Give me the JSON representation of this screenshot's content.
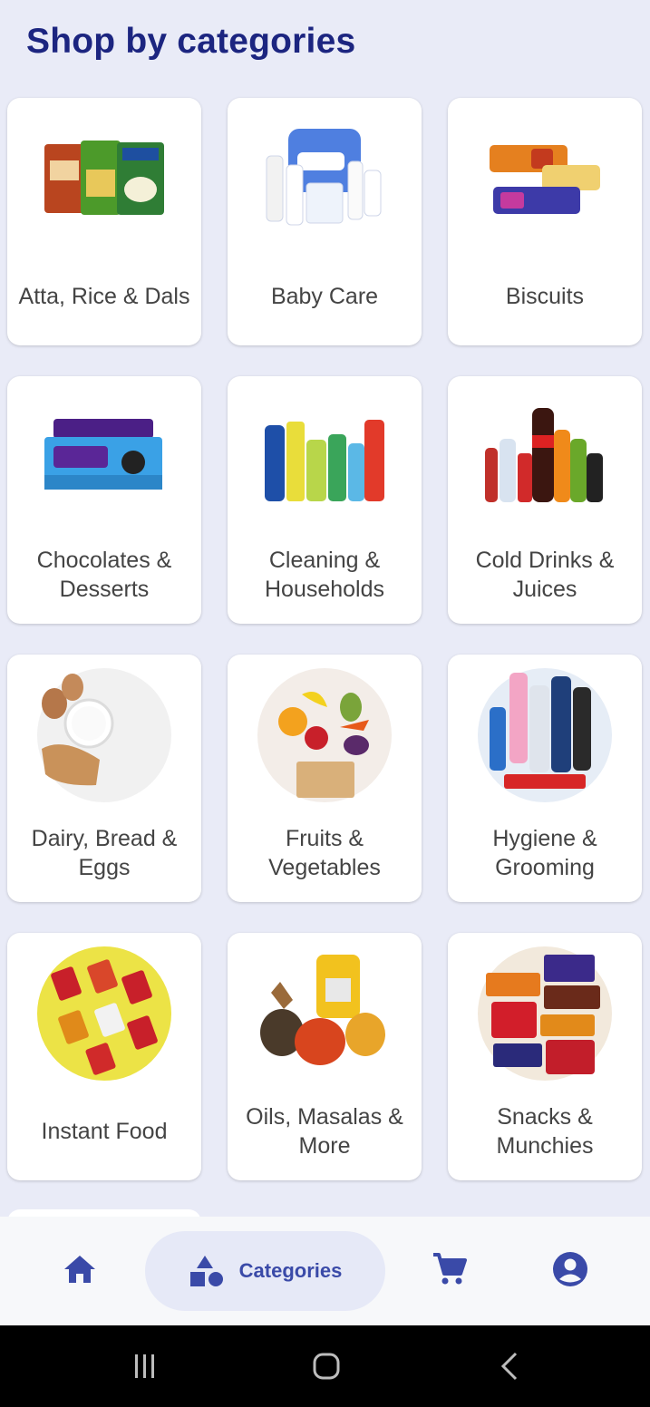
{
  "page": {
    "title": "Shop by categories"
  },
  "categories": [
    {
      "label": "Atta, Rice & Dals",
      "icon": "rice-packs-image"
    },
    {
      "label": "Baby Care",
      "icon": "baby-care-image"
    },
    {
      "label": "Biscuits",
      "icon": "biscuits-image"
    },
    {
      "label": "Chocolates & Desserts",
      "icon": "chocolates-image"
    },
    {
      "label": "Cleaning & Households",
      "icon": "cleaning-products-image"
    },
    {
      "label": "Cold Drinks & Juices",
      "icon": "cold-drinks-image"
    },
    {
      "label": "Dairy, Bread & Eggs",
      "icon": "dairy-image"
    },
    {
      "label": "Fruits & Vegetables",
      "icon": "fruits-vegetables-image"
    },
    {
      "label": "Hygiene & Grooming",
      "icon": "hygiene-image"
    },
    {
      "label": "Instant Food",
      "icon": "instant-food-image"
    },
    {
      "label": "Oils, Masalas & More",
      "icon": "spices-oils-image"
    },
    {
      "label": "Snacks & Munchies",
      "icon": "snacks-image"
    }
  ],
  "bottom_nav": {
    "home_icon": "home-icon",
    "categories_label": "Categories",
    "categories_icon": "shapes-icon",
    "cart_icon": "cart-icon",
    "profile_icon": "account-circle-icon",
    "active": "Categories",
    "accent": "#3a4aa8"
  },
  "system_nav": {
    "recents_icon": "recents-icon",
    "home_icon": "system-home-icon",
    "back_icon": "back-icon"
  },
  "colors": {
    "background": "#e9ebf7",
    "title": "#1c2580",
    "card": "#ffffff"
  }
}
